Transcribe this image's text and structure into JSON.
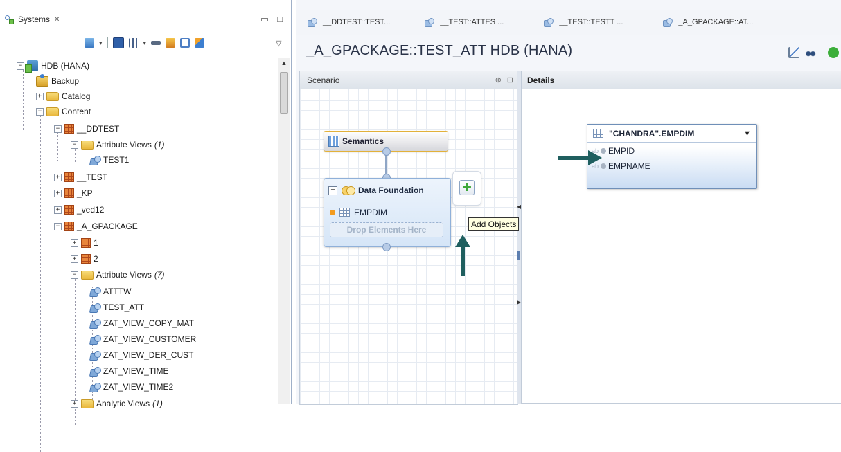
{
  "systems": {
    "tab_label": "Systems",
    "tab_close": "✕",
    "min_label": "▭",
    "max_label": "□",
    "view_menu": "▽"
  },
  "tree": {
    "root": "HDB (HANA)",
    "backup": "Backup",
    "catalog": "Catalog",
    "content": "Content",
    "ddtest": "__DDTEST",
    "ddtest_av": "Attribute Views",
    "ddtest_av_count": "(1)",
    "test1": "TEST1",
    "test": "__TEST",
    "kp": "_KP",
    "ved12": "_ved12",
    "a_gpackage": "_A_GPACKAGE",
    "pkg1": "1",
    "pkg2": "2",
    "gp_av": "Attribute Views",
    "gp_av_count": "(7)",
    "views": [
      "ATTTW",
      "TEST_ATT",
      "ZAT_VIEW_COPY_MAT",
      "ZAT_VIEW_CUSTOMER",
      "ZAT_VIEW_DER_CUST",
      "ZAT_VIEW_TIME",
      "ZAT_VIEW_TIME2"
    ],
    "analytic": "Analytic Views",
    "analytic_count": "(1)"
  },
  "editor": {
    "tabs": [
      "__DDTEST::TEST...",
      "__TEST::ATTES ...",
      "__TEST::TESTT ...",
      "_A_GPACKAGE::AT..."
    ],
    "title": "_A_GPACKAGE::TEST_ATT HDB (HANA)"
  },
  "scenario": {
    "header": "Scenario",
    "semantics": "Semantics",
    "data_foundation": "Data Foundation",
    "table": "EMPDIM",
    "drop": "Drop Elements Here",
    "tooltip": "Add Objects"
  },
  "details": {
    "header": "Details",
    "table_title": "\"CHANDRA\".EMPDIM",
    "columns": [
      "EMPID",
      "EMPNAME"
    ]
  },
  "colors": {
    "annotation_arrow": "#1f5f5f",
    "accent": "#3f6fb0"
  }
}
